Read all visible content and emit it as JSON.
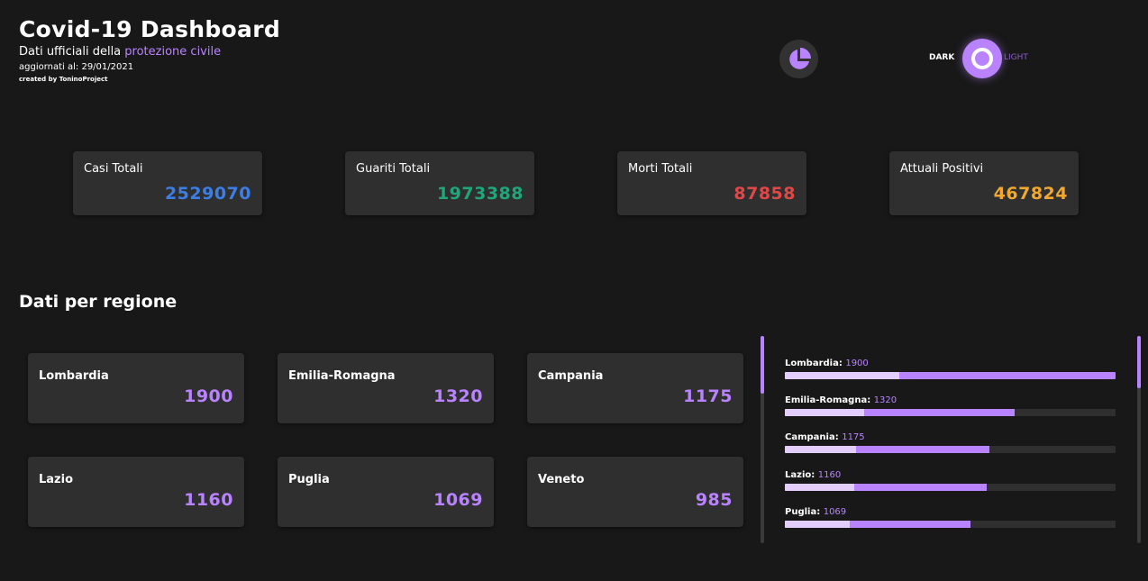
{
  "header": {
    "title": "Covid-19 Dashboard",
    "subtitle_prefix": "Dati ufficiali della",
    "subtitle_accent": "protezione civile",
    "updated": "aggiornati al: 29/01/2021",
    "credits": "created by ToninoProject",
    "chart_icon": "pie-chart-icon"
  },
  "theme": {
    "dark_label": "DARK",
    "light_label": "LIGHT",
    "active": "dark"
  },
  "stats": [
    {
      "label": "Casi Totali",
      "value": "2529070",
      "color": "#3d7ee6"
    },
    {
      "label": "Guariti Totali",
      "value": "1973388",
      "color": "#1fa67a"
    },
    {
      "label": "Morti Totali",
      "value": "87858",
      "color": "#e04848"
    },
    {
      "label": "Attuali Positivi",
      "value": "467824",
      "color": "#f0a830"
    }
  ],
  "section_title": "Dati per regione",
  "regions": [
    {
      "label": "Lombardia",
      "value": "1900"
    },
    {
      "label": "Emilia-Romagna",
      "value": "1320"
    },
    {
      "label": "Campania",
      "value": "1175"
    },
    {
      "label": "Lazio",
      "value": "1160"
    },
    {
      "label": "Puglia",
      "value": "1069"
    },
    {
      "label": "Veneto",
      "value": "985"
    }
  ],
  "bars": [
    {
      "label": "Lombardia:",
      "value": "1900",
      "fraction": 1.0,
      "inner_fraction": 0.345
    },
    {
      "label": "Emilia-Romagna:",
      "value": "1320",
      "fraction": 0.695,
      "inner_fraction": 0.24
    },
    {
      "label": "Campania:",
      "value": "1175",
      "fraction": 0.618,
      "inner_fraction": 0.215
    },
    {
      "label": "Lazio:",
      "value": "1160",
      "fraction": 0.61,
      "inner_fraction": 0.21
    },
    {
      "label": "Puglia:",
      "value": "1069",
      "fraction": 0.562,
      "inner_fraction": 0.195
    }
  ],
  "accent": "#b983ff"
}
